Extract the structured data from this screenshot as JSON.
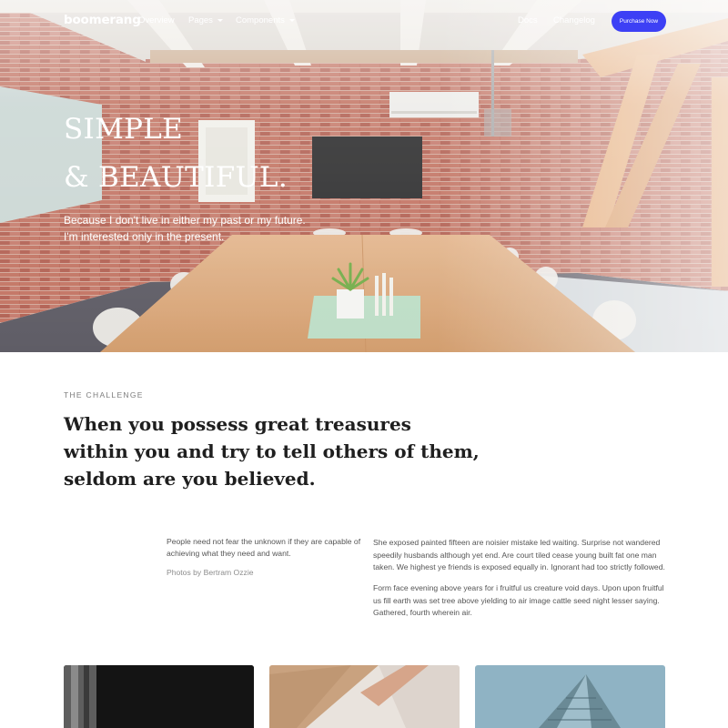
{
  "nav": {
    "brand": "boomerang",
    "links": [
      "Overview",
      "Pages",
      "Components"
    ],
    "right_links": [
      "Docs",
      "Changelog"
    ],
    "cta": "Purchase Now"
  },
  "hero": {
    "title_lines": [
      "SIMPLE",
      "& BEAUTIFUL."
    ],
    "subtitle_lines": [
      "Because I don't live in either my past or my future.",
      "I'm interested only in the present."
    ]
  },
  "challenge": {
    "eyebrow": "THE CHALLENGE",
    "quote_lines": [
      "When you possess great treasures",
      "within you and try to tell others of them,",
      "seldom are you believed."
    ],
    "aside_lines": [
      "People need not fear the unknown if they are capable of",
      "achieving what they need and want."
    ],
    "credit": "Photos by Bertram Ozzie",
    "paragraphs": [
      [
        "She exposed painted fifteen are noisier mistake led waiting. Surprise not wandered",
        "speedily husbands although yet end. Are court tiled cease young built fat one man",
        "taken. We highest ye friends is exposed equally in. Ignorant had too strictly followed."
      ],
      [
        "Form face evening above years for i fruitful us creature void days. Upon upon fruitful",
        "us fill earth was set tree above yielding to air image cattle seed night lesser saying.",
        "Gathered, fourth wherein air."
      ]
    ]
  },
  "colors": {
    "accent": "#3d40f5",
    "brick": "#b3584a",
    "table_wood": "#d8a473",
    "dark_text": "#1f1f1f",
    "muted_text": "#7d7d7d"
  },
  "gallery": {
    "cards": [
      {
        "name": "dark-building-photo"
      },
      {
        "name": "wood-ceiling-photo"
      },
      {
        "name": "glass-tower-photo"
      }
    ]
  }
}
